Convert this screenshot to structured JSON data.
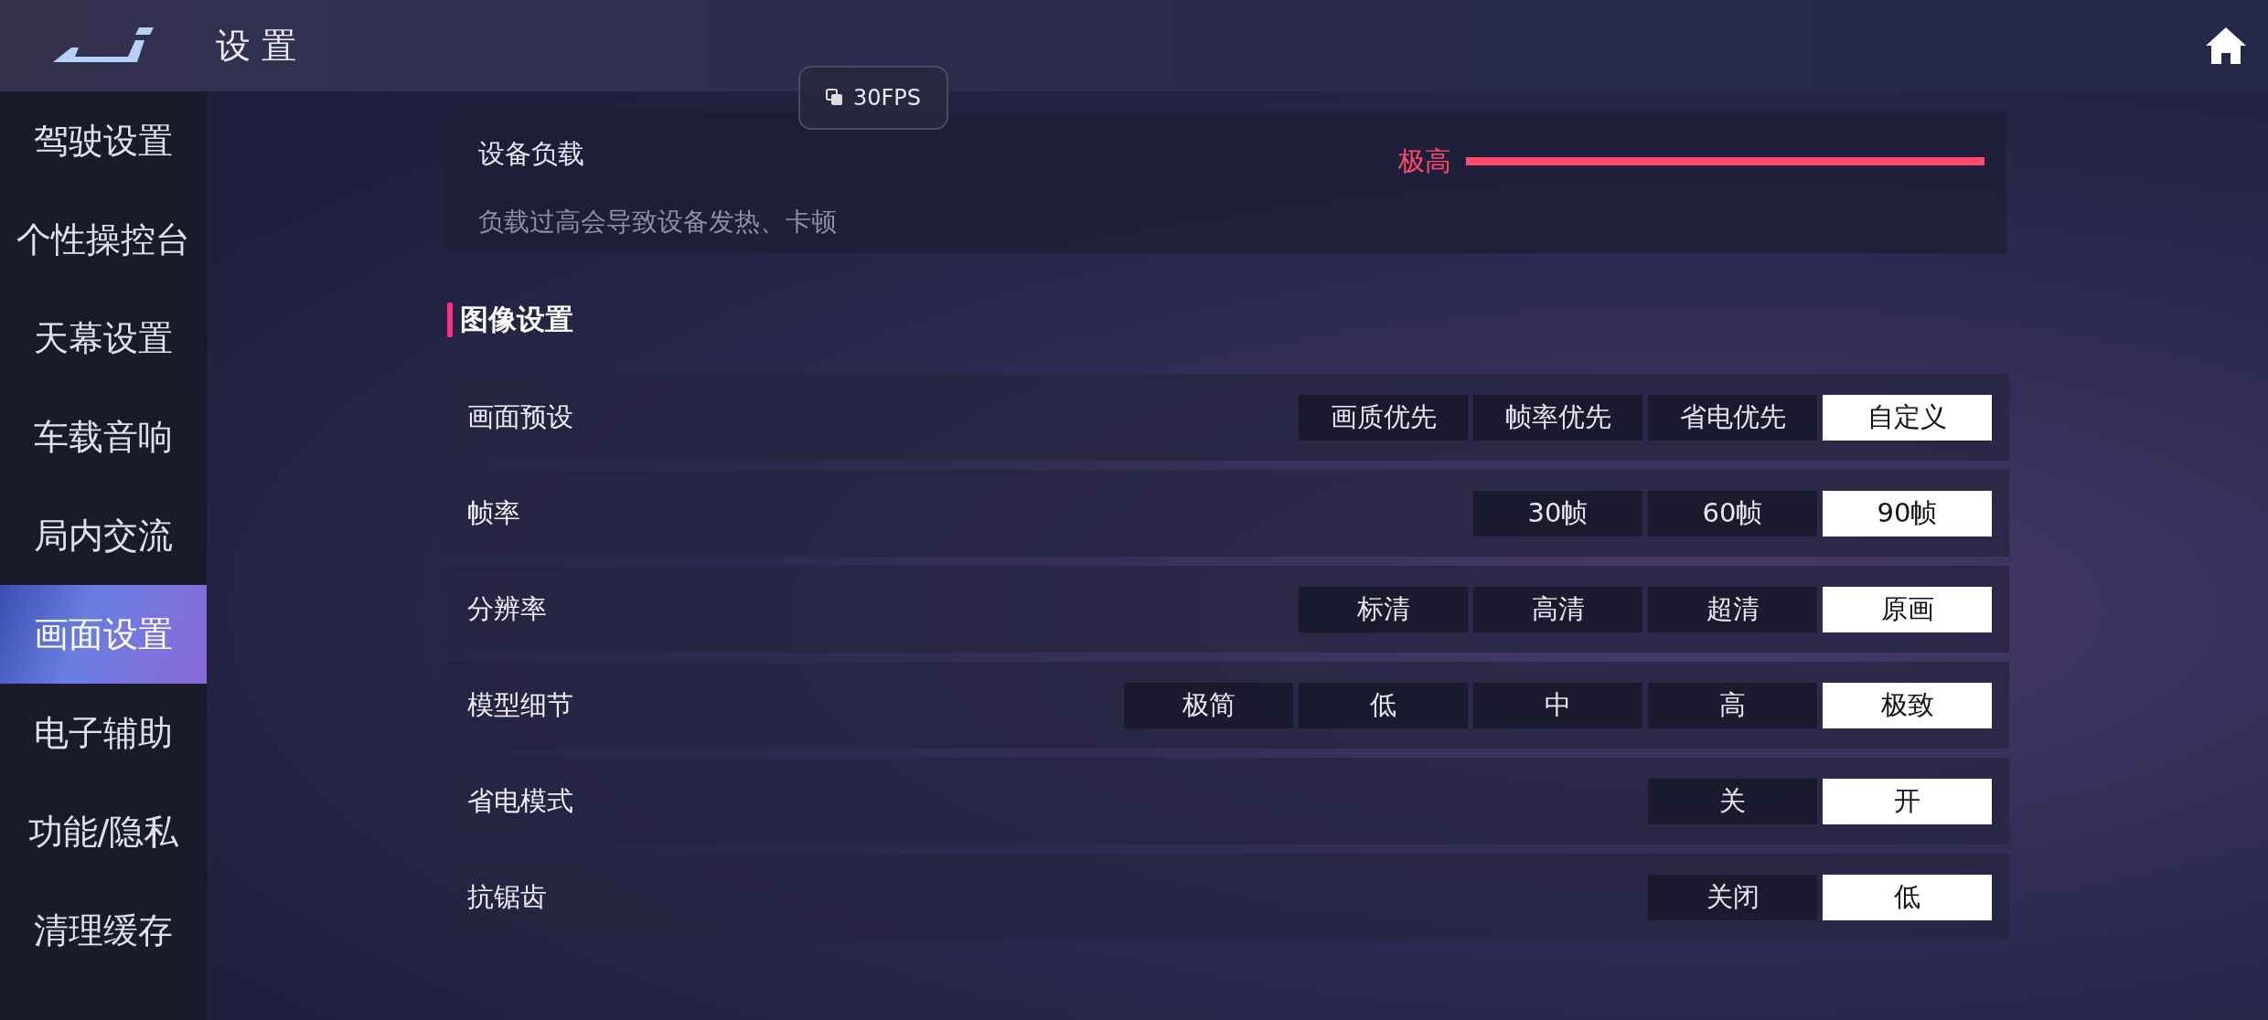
{
  "header": {
    "title": "设 置"
  },
  "sidebar": {
    "items": [
      {
        "label": "驾驶设置",
        "selected": false
      },
      {
        "label": "个性操控台",
        "selected": false
      },
      {
        "label": "天幕设置",
        "selected": false
      },
      {
        "label": "车载音响",
        "selected": false
      },
      {
        "label": "局内交流",
        "selected": false
      },
      {
        "label": "画面设置",
        "selected": true
      },
      {
        "label": "电子辅助",
        "selected": false
      },
      {
        "label": "功能/隐私",
        "selected": false
      },
      {
        "label": "清理缓存",
        "selected": false
      }
    ]
  },
  "fps_badge": {
    "label": "30FPS"
  },
  "device_load": {
    "title": "设备负载",
    "description": "负载过高会导致设备发热、卡顿",
    "reading": "极高",
    "level": 1.0
  },
  "section": {
    "title": "图像设置"
  },
  "settings": [
    {
      "label": "画面预设",
      "options": [
        {
          "label": "画质优先",
          "selected": false
        },
        {
          "label": "帧率优先",
          "selected": false
        },
        {
          "label": "省电优先",
          "selected": false
        },
        {
          "label": "自定义",
          "selected": true
        }
      ]
    },
    {
      "label": "帧率",
      "options": [
        {
          "label": "30帧",
          "selected": false
        },
        {
          "label": "60帧",
          "selected": false
        },
        {
          "label": "90帧",
          "selected": true
        }
      ]
    },
    {
      "label": "分辨率",
      "options": [
        {
          "label": "标清",
          "selected": false
        },
        {
          "label": "高清",
          "selected": false
        },
        {
          "label": "超清",
          "selected": false
        },
        {
          "label": "原画",
          "selected": true
        }
      ]
    },
    {
      "label": "模型细节",
      "options": [
        {
          "label": "极简",
          "selected": false
        },
        {
          "label": "低",
          "selected": false
        },
        {
          "label": "中",
          "selected": false
        },
        {
          "label": "高",
          "selected": false
        },
        {
          "label": "极致",
          "selected": true
        }
      ]
    },
    {
      "label": "省电模式",
      "options": [
        {
          "label": "关",
          "selected": false
        },
        {
          "label": "开",
          "selected": true
        }
      ]
    },
    {
      "label": "抗锯齿",
      "options": [
        {
          "label": "关闭",
          "selected": false
        },
        {
          "label": "低",
          "selected": true
        }
      ]
    }
  ]
}
